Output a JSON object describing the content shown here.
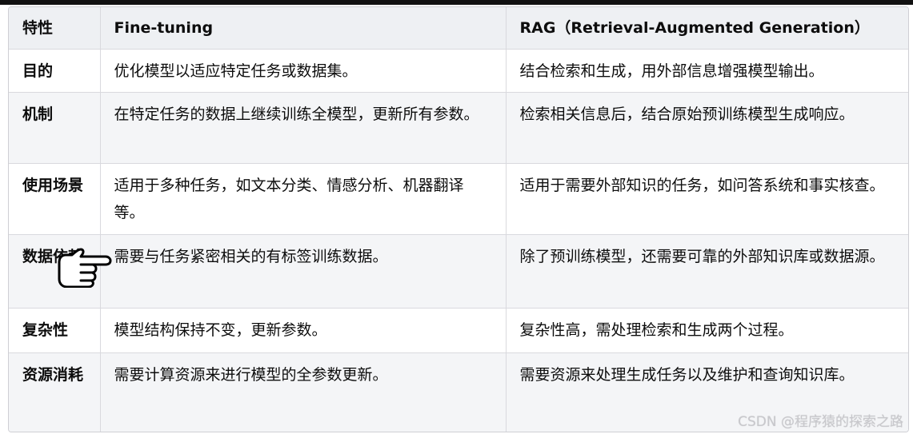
{
  "table": {
    "headers": [
      "特性",
      "Fine-tuning",
      "RAG（Retrieval-Augmented Generation）"
    ],
    "rows": [
      {
        "feature": "目的",
        "fine_tuning": "优化模型以适应特定任务或数据集。",
        "rag": "结合检索和生成，用外部信息增强模型输出。"
      },
      {
        "feature": "机制",
        "fine_tuning": "在特定任务的数据上继续训练全模型，更新所有参数。",
        "rag": "检索相关信息后，结合原始预训练模型生成响应。"
      },
      {
        "feature": "使用场景",
        "fine_tuning": "适用于多种任务，如文本分类、情感分析、机器翻译等。",
        "rag": "适用于需要外部知识的任务，如问答系统和事实核查。"
      },
      {
        "feature": "数据依赖",
        "fine_tuning": "需要与任务紧密相关的有标签训练数据。",
        "rag": "除了预训练模型，还需要可靠的外部知识库或数据源。"
      },
      {
        "feature": "复杂性",
        "fine_tuning": "模型结构保持不变，更新参数。",
        "rag": "复杂性高，需处理检索和生成两个过程。"
      },
      {
        "feature": "资源消耗",
        "fine_tuning": "需要计算资源来进行模型的全参数更新。",
        "rag": "需要资源来处理生成任务以及维护和查询知识库。"
      }
    ]
  },
  "cursor": {
    "icon": "pointing-hand-icon"
  },
  "watermark": {
    "text": "CSDN @程序猿的探索之路"
  }
}
